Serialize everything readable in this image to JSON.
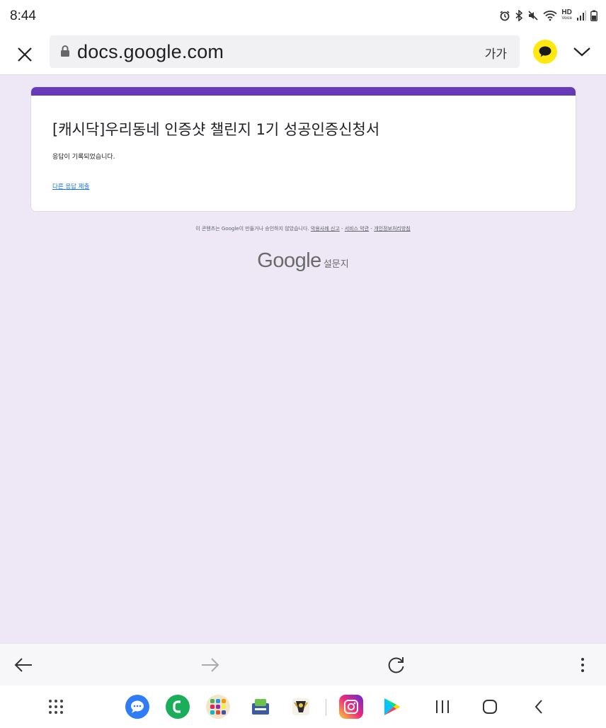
{
  "status_bar": {
    "time": "8:44",
    "icons": [
      "alarm-icon",
      "bluetooth-icon",
      "mute-icon",
      "wifi-icon",
      "hd-voice-icon",
      "signal-icon",
      "battery-icon"
    ],
    "hd_label": "HD",
    "voice_label": "Voice"
  },
  "browser": {
    "url": "docs.google.com",
    "text_size_label": "가가",
    "colors": {
      "kakao": "#ffe812"
    }
  },
  "form": {
    "accent_color": "#673ab7",
    "title": "[캐시닥]우리동네 인증샷 챌린지 1기 성공인증신청서",
    "confirmation": "응답이 기록되었습니다.",
    "another_response_link": "다른 응답 제출"
  },
  "footer": {
    "disclaimer": "이 콘텐츠는 Google이 만들거나 승인하지 않았습니다.",
    "report_abuse": "악용사례 신고",
    "terms": "서비스 약관",
    "privacy": "개인정보처리방침",
    "separator": " - "
  },
  "branding": {
    "google": "Google",
    "forms": "설문지"
  },
  "toolbar": {
    "icons": [
      "back-arrow-icon",
      "forward-arrow-icon",
      "reload-icon",
      "more-vert-icon"
    ]
  },
  "dock": {
    "apps": [
      "messages-app",
      "phone-app",
      "app-folder",
      "calculator-app",
      "game-app",
      "instagram-app",
      "play-store-app"
    ],
    "nav": [
      "recents-icon",
      "home-icon",
      "back-nav-icon"
    ]
  }
}
